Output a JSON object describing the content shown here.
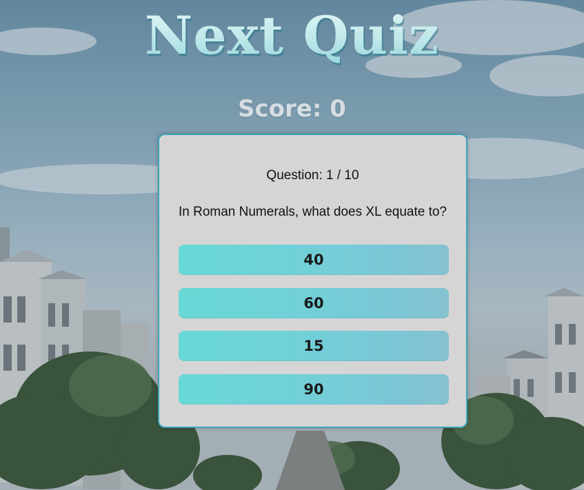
{
  "header": {
    "title": "Next Quiz",
    "score_label": "Score: 0"
  },
  "quiz": {
    "counter": "Question: 1 / 10",
    "question": "In Roman Numerals, what does XL equate to?",
    "answers": [
      "40",
      "60",
      "15",
      "90"
    ]
  },
  "colors": {
    "accent": "#3aa6b9",
    "answer_gradient_start": "#68d8d6",
    "answer_gradient_end": "#86c2d0",
    "card_background": "#d5d5d5"
  }
}
